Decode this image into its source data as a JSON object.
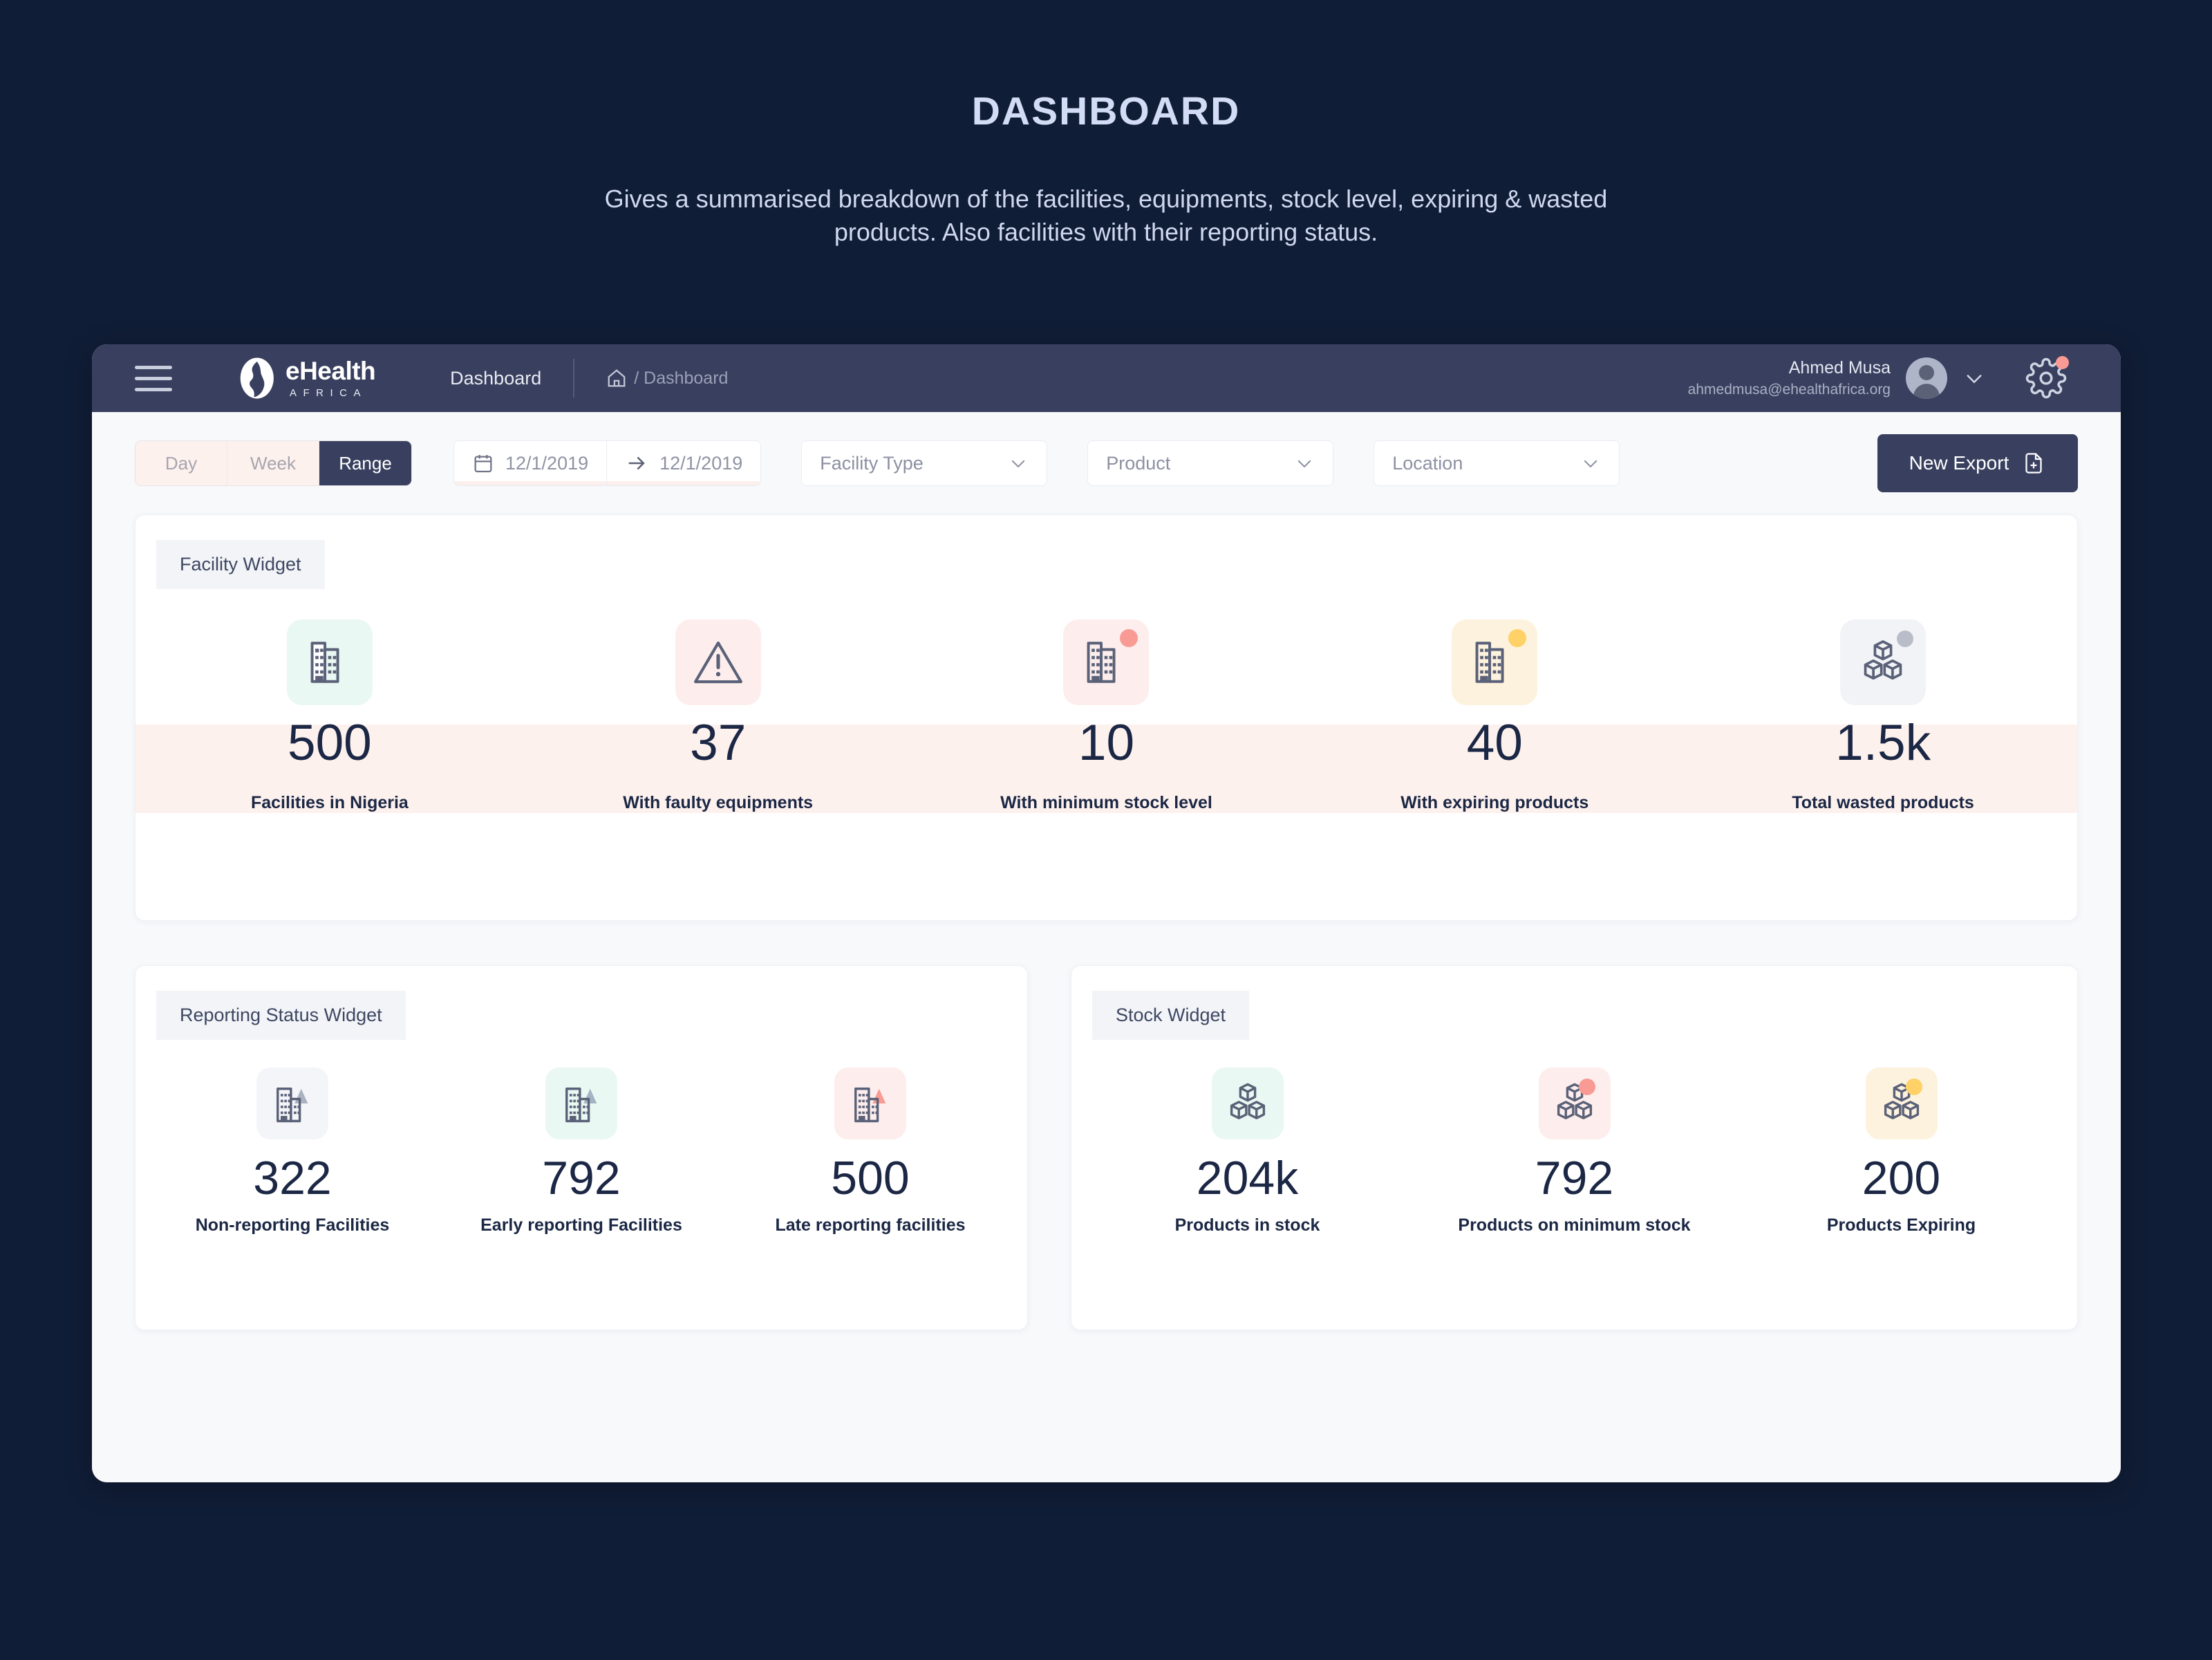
{
  "hero": {
    "title": "DASHBOARD",
    "subtitle": "Gives a summarised breakdown of the facilities, equipments, stock level, expiring & wasted  products. Also facilities with their reporting status."
  },
  "topbar": {
    "menu_icon": "hamburger-icon",
    "brand_name": "eHealth",
    "brand_sub": "AFRICA",
    "nav_link": "Dashboard",
    "breadcrumb_home_icon": "home-icon",
    "breadcrumb_text": "/ Dashboard",
    "user_name": "Ahmed Musa",
    "user_email": "ahmedmusa@ehealthafrica.org",
    "avatar_icon": "avatar-icon",
    "chevron_icon": "chevron-down-icon",
    "settings_icon": "gear-icon",
    "settings_badge_color": "#f99a95",
    "background": "#39405f"
  },
  "filters": {
    "segments": [
      {
        "label": "Day",
        "active": false
      },
      {
        "label": "Week",
        "active": false
      },
      {
        "label": "Range",
        "active": true
      }
    ],
    "date_start": "12/1/2019",
    "date_end": "12/1/2019",
    "calendar_icon": "calendar-icon",
    "arrow_icon": "arrow-right-icon",
    "selects": [
      {
        "label": "Facility Type",
        "icon": "chevron-down-icon"
      },
      {
        "label": "Product",
        "icon": "chevron-down-icon"
      },
      {
        "label": "Location",
        "icon": "chevron-down-icon"
      }
    ],
    "export_label": "New Export",
    "export_icon": "file-plus-icon"
  },
  "facility_widget": {
    "tag": "Facility Widget",
    "band_color": "#fdf1ee",
    "stats": [
      {
        "value": "500",
        "label": "Facilities in Nigeria",
        "icon": "building-icon",
        "bg": "#e9f8f2",
        "badge": null
      },
      {
        "value": "37",
        "label": "With faulty equipments",
        "icon": "warning-triangle-icon",
        "bg": "#fdeeed",
        "badge": null
      },
      {
        "value": "10",
        "label": "With minimum stock level",
        "icon": "building-icon",
        "bg": "#fdeeed",
        "badge": "#f99a95"
      },
      {
        "value": "40",
        "label": "With expiring products",
        "icon": "building-icon",
        "bg": "#fdf2dd",
        "badge": "#ffd166"
      },
      {
        "value": "1.5k",
        "label": "Total wasted products",
        "icon": "boxes-icon",
        "bg": "#f2f3f6",
        "badge": "#b9bdc9"
      }
    ]
  },
  "reporting_widget": {
    "tag": "Reporting Status Widget",
    "stats": [
      {
        "value": "322",
        "label": "Non-reporting Facilities",
        "icon": "building-triangle-icon",
        "bg": "#f4f5f8",
        "triangle": "#a9b2c0"
      },
      {
        "value": "792",
        "label": "Early reporting Facilities",
        "icon": "building-triangle-icon",
        "bg": "#e9f8f2",
        "triangle": "#a3b3c3"
      },
      {
        "value": "500",
        "label": "Late reporting facilities",
        "icon": "building-triangle-icon",
        "bg": "#fdeeed",
        "triangle": "#f99a95"
      }
    ]
  },
  "stock_widget": {
    "tag": "Stock Widget",
    "stats": [
      {
        "value": "204k",
        "label": "Products in stock",
        "icon": "boxes-icon",
        "bg": "#e9f8f2",
        "badge": null
      },
      {
        "value": "792",
        "label": "Products on minimum stock",
        "icon": "boxes-icon",
        "bg": "#fdeeed",
        "badge": "#f99a95"
      },
      {
        "value": "200",
        "label": "Products Expiring",
        "icon": "boxes-icon",
        "bg": "#fdf2dd",
        "badge": "#ffd166"
      }
    ]
  },
  "theme": {
    "page_bg": "#101d36",
    "accent_navy": "#39405f",
    "text_dark": "#1b2744"
  }
}
